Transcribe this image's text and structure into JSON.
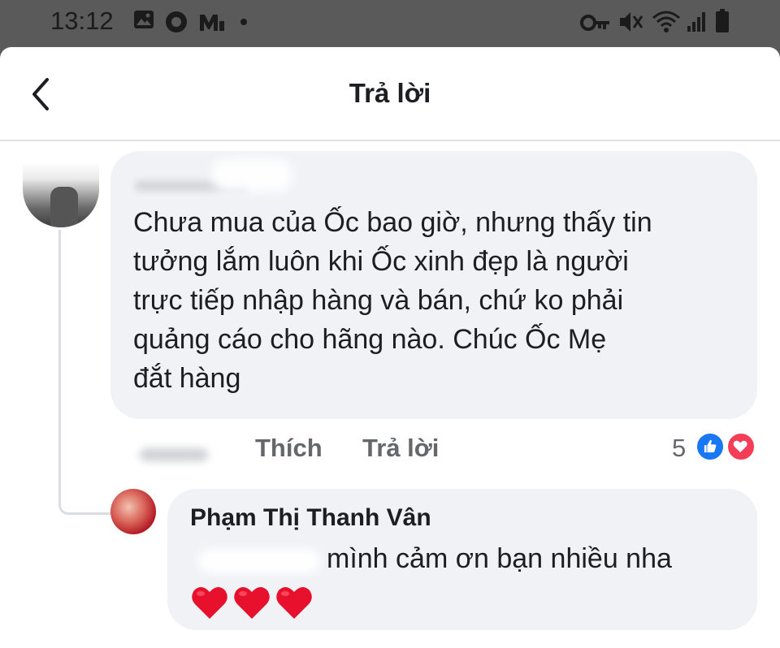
{
  "status_bar": {
    "time": "13:12",
    "icons": [
      "gallery-icon",
      "circle-app-icon",
      "m-app-icon",
      "dot-icon",
      "key-icon",
      "mute-icon",
      "wifi-icon",
      "signal-icon",
      "battery-icon"
    ]
  },
  "header": {
    "title": "Trả lời",
    "back_icon": "chevron-left-icon"
  },
  "comment": {
    "text": "Chưa mua của Ốc bao giờ, nhưng thấy tin\ntưởng lắm luôn khi Ốc xinh đẹp là người\ntrực tiếp nhập hàng và bán, chứ ko phải\nquảng cáo cho hãng nào. Chúc Ốc Mẹ\nđắt hàng",
    "actions": {
      "like_label": "Thích",
      "reply_label": "Trả lời"
    },
    "reaction_count": "5",
    "reaction_icons": [
      "like-icon",
      "love-icon"
    ]
  },
  "reply": {
    "author": "Phạm Thị Thanh Vân",
    "text": "mình cảm ơn bạn nhiều nha",
    "emoji": [
      "heart-icon",
      "heart-icon",
      "heart-icon"
    ]
  },
  "colors": {
    "status_bar_bg": "#5a5a5a",
    "bubble_bg": "#f0f2f5",
    "secondary_text": "#65676b",
    "like_blue": "#1877f2",
    "love_red": "#f33e58"
  }
}
